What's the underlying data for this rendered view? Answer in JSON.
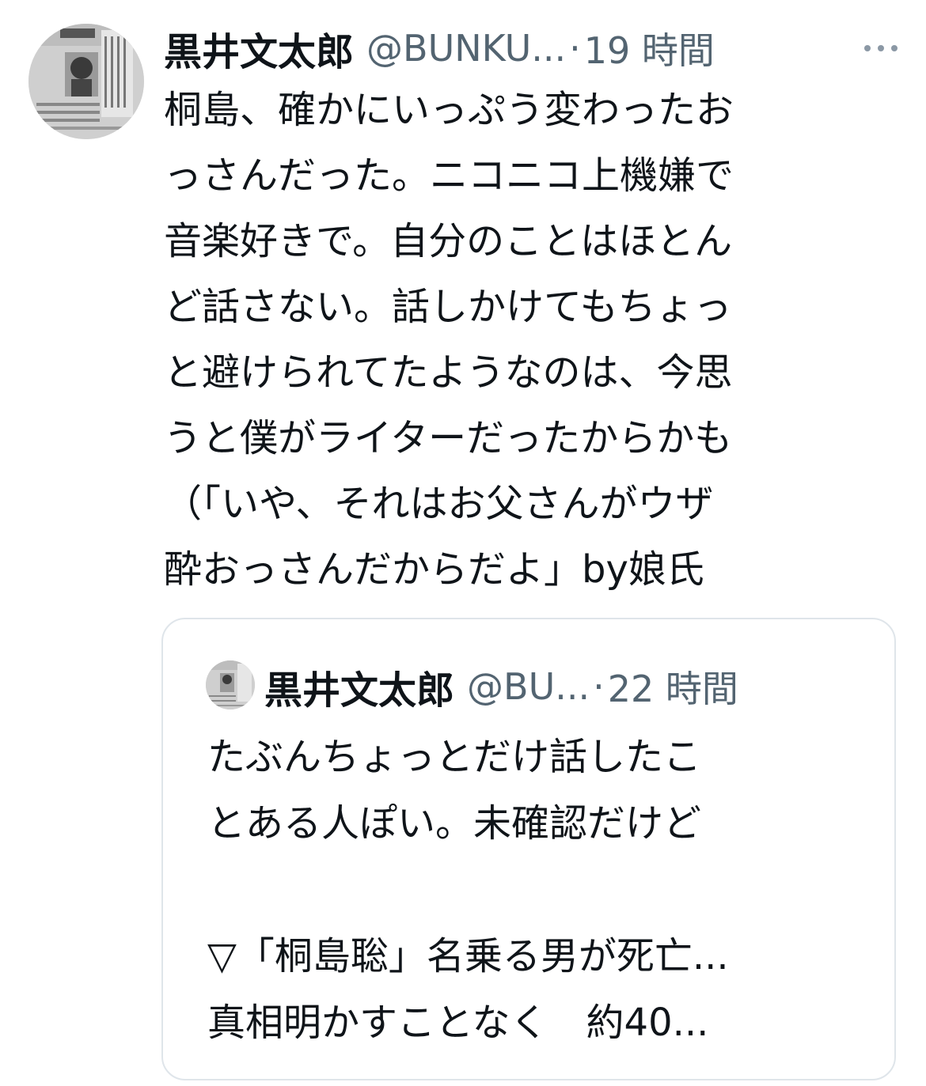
{
  "tweet": {
    "author_name": "黒井文太郎",
    "handle": "@BUNKU...",
    "separator": "·",
    "time": "19 時間",
    "more_icon": "more-dots-icon",
    "text_lines": [
      "桐島、確かにいっぷう変わったお",
      "っさんだった。ニコニコ上機嫌で",
      "音楽好きで。自分のことはほとん",
      "ど話さない。話しかけてもちょっ",
      "と避けられてたようなのは、今思",
      "うと僕がライターだったからかも",
      "（「いや、それはお父さんがウザ",
      "酔おっさんだからだよ」by娘氏"
    ]
  },
  "quoted": {
    "author_name": "黒井文太郎",
    "handle": "@BU...",
    "separator": "·",
    "time": "22 時間",
    "text_lines": [
      "たぶんちょっとだけ話したこ",
      "とある人ぽい。未確認だけど",
      "",
      "▽「桐島聡」名乗る男が死亡...",
      "真相明かすことなく　約40..."
    ]
  }
}
